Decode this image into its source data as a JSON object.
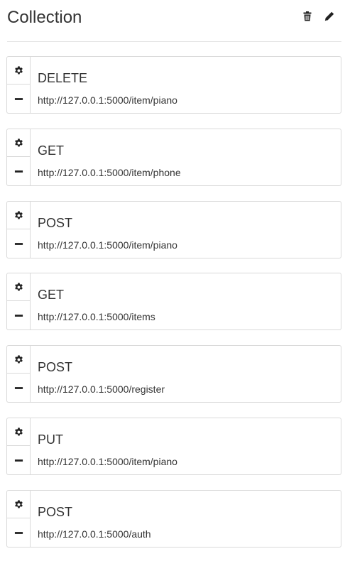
{
  "header": {
    "title": "Collection",
    "icons": [
      "trash-icon",
      "pencil-icon"
    ]
  },
  "requests": [
    {
      "method": "DELETE",
      "url": "http://127.0.0.1:5000/item/piano"
    },
    {
      "method": "GET",
      "url": "http://127.0.0.1:5000/item/phone"
    },
    {
      "method": "POST",
      "url": "http://127.0.0.1:5000/item/piano"
    },
    {
      "method": "GET",
      "url": "http://127.0.0.1:5000/items"
    },
    {
      "method": "POST",
      "url": "http://127.0.0.1:5000/register"
    },
    {
      "method": "PUT",
      "url": "http://127.0.0.1:5000/item/piano"
    },
    {
      "method": "POST",
      "url": "http://127.0.0.1:5000/auth"
    }
  ],
  "request_icons": [
    "gear-icon",
    "minus-icon"
  ],
  "colors": {
    "border": "#d9d9d9",
    "text": "#333333",
    "icon": "#222222"
  }
}
